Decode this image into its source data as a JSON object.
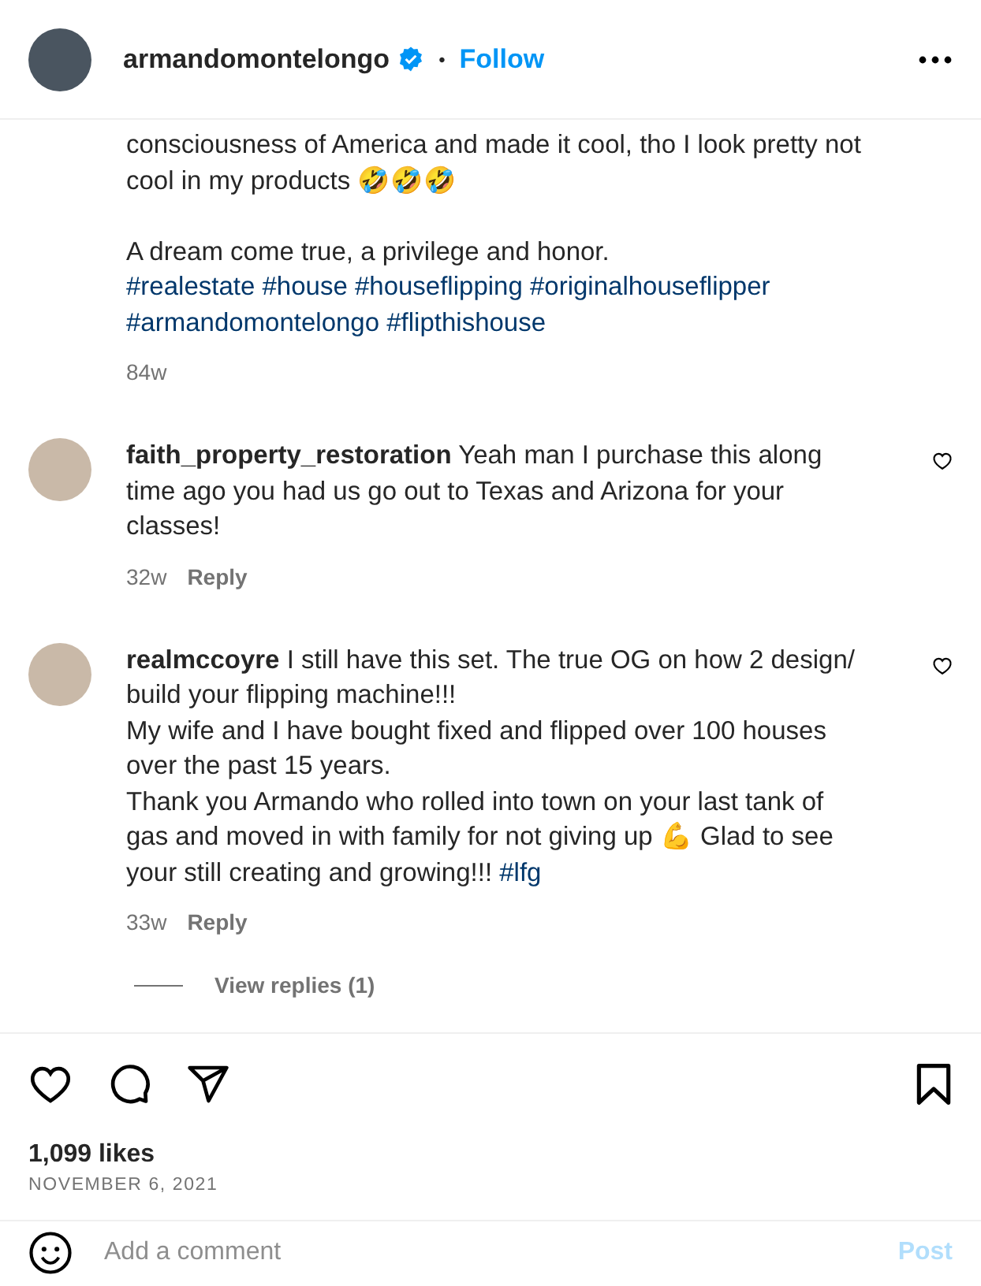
{
  "header": {
    "username": "armandomontelongo",
    "verified": true,
    "separator": "•",
    "follow": "Follow"
  },
  "caption": {
    "paragraphs": [
      "consciousness of America and made it cool, tho I look pretty not cool in my products 🤣🤣🤣",
      "A dream come true, a privilege and honor."
    ],
    "hashtags": [
      "#realestate",
      "#house",
      "#houseflipping",
      "#originalhouseflipper",
      "#armandomontelongo",
      "#flipthishouse"
    ],
    "age": "84w"
  },
  "comments": [
    {
      "username": "faith_property_restoration",
      "text": "Yeah man I purchase this along time ago you had us go out to Texas and Arizona for your classes!",
      "age": "32w",
      "reply": "Reply",
      "liked": false
    },
    {
      "username": "realmccoyre",
      "text": "I still have this set. The true OG on how 2 design/ build your flipping machine!!!\nMy wife and I have bought fixed and flipped over 100 houses over the past 15 years.\nThank you Armando who rolled into town on your last tank of gas and moved in with family for not giving up 💪 Glad to see your still creating and growing!!!",
      "hashtags": [
        "#lfg"
      ],
      "age": "33w",
      "reply": "Reply",
      "liked": false,
      "view_replies": "View replies (1)"
    }
  ],
  "actions": {
    "liked": false,
    "saved": false,
    "likes": "1,099 likes",
    "date": "NOVEMBER 6, 2021"
  },
  "add_comment": {
    "placeholder": "Add a comment",
    "post": "Post",
    "post_disabled": true
  }
}
